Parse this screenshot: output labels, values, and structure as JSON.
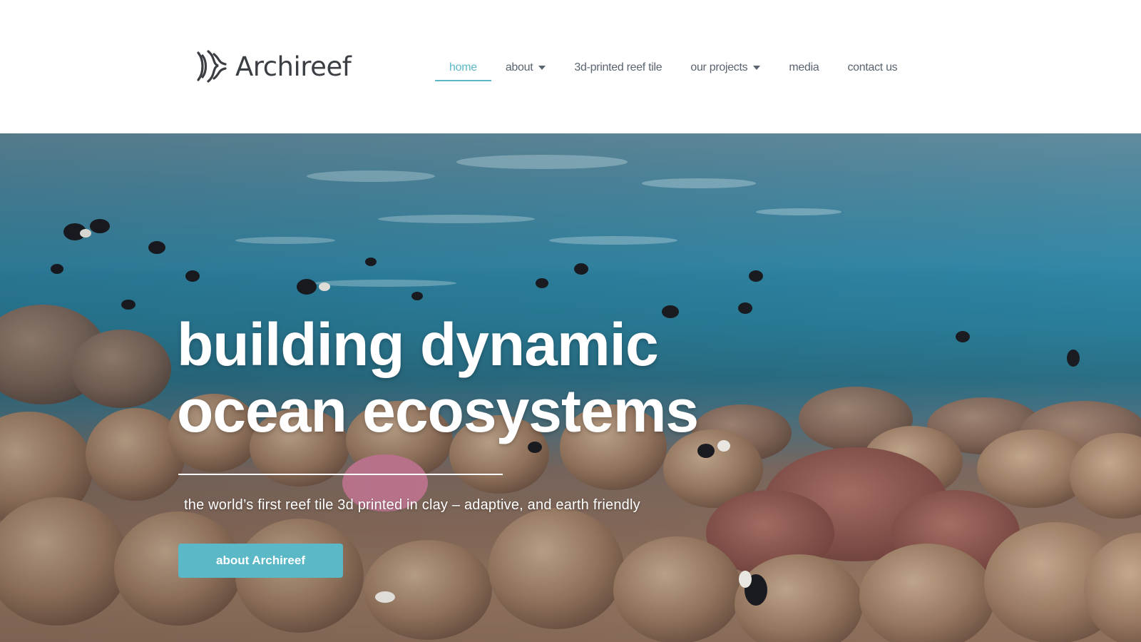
{
  "brand": {
    "name": "Archireef",
    "logo_icon": "archireef-wave-mark-icon",
    "text_color": "#3b3f44"
  },
  "nav": {
    "items": [
      {
        "label": "home",
        "active": true,
        "has_dropdown": false
      },
      {
        "label": "about",
        "active": false,
        "has_dropdown": true
      },
      {
        "label": "3d-printed reef tile",
        "active": false,
        "has_dropdown": false
      },
      {
        "label": "our projects",
        "active": false,
        "has_dropdown": true
      },
      {
        "label": "media",
        "active": false,
        "has_dropdown": false
      },
      {
        "label": "contact us",
        "active": false,
        "has_dropdown": false
      }
    ],
    "text_color": "#5a6470",
    "active_color": "#5bb8c6"
  },
  "hero": {
    "title_line1": "building dynamic",
    "title_line2": "ocean ecosystems",
    "subtitle": "the world’s first reef tile 3d printed in clay – adaptive, and earth friendly",
    "button_label": "about Archireef",
    "button_color": "#5bb8c6",
    "background": "underwater coral reef with fish"
  }
}
